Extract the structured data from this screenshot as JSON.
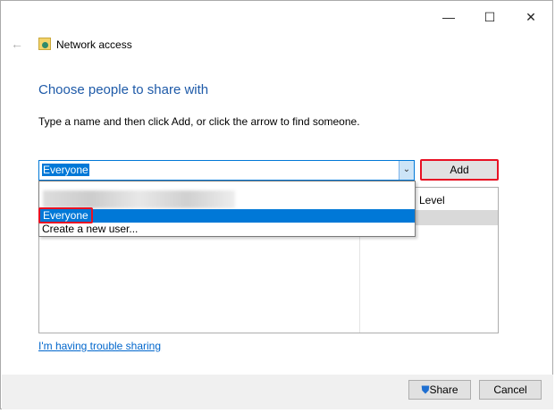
{
  "window": {
    "title": "Network access",
    "controls": {
      "minimize": "—",
      "maximize": "☐",
      "close": "✕"
    }
  },
  "heading": "Choose people to share with",
  "instruction": "Type a name and then click Add, or click the arrow to find someone.",
  "combo": {
    "value": "Everyone"
  },
  "add_label": "Add",
  "list": {
    "column_level": "Level"
  },
  "dropdown": {
    "items": [
      "Everyone",
      "Create a new user..."
    ]
  },
  "trouble_link": "I'm having trouble sharing",
  "share_label": "Share",
  "cancel_label": "Cancel"
}
